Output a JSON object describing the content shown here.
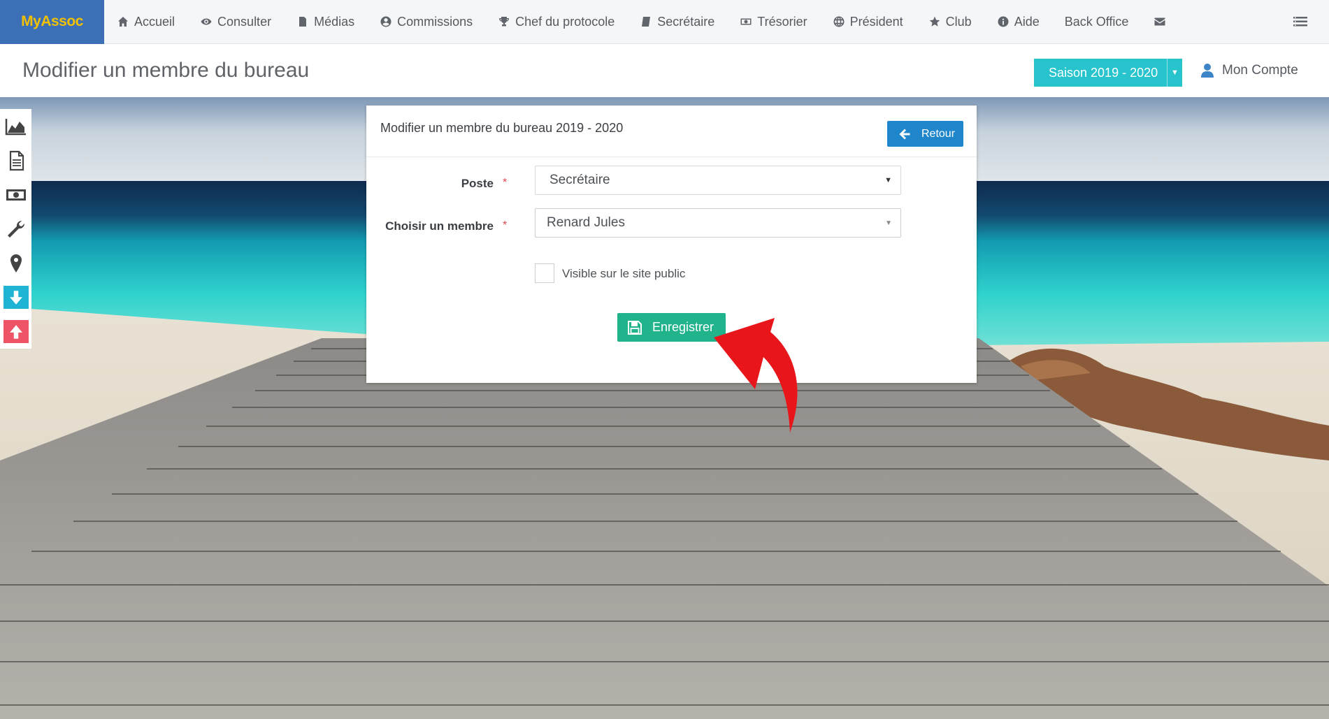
{
  "brand": "MyAssoc",
  "nav": [
    {
      "label": "Accueil",
      "icon": "home-icon"
    },
    {
      "label": "Consulter",
      "icon": "eye-icon"
    },
    {
      "label": "Médias",
      "icon": "file-icon"
    },
    {
      "label": "Commissions",
      "icon": "user-circle-icon"
    },
    {
      "label": "Chef du protocole",
      "icon": "trophy-icon"
    },
    {
      "label": "Secrétaire",
      "icon": "book-icon"
    },
    {
      "label": "Trésorier",
      "icon": "money-icon"
    },
    {
      "label": "Président",
      "icon": "globe-icon"
    },
    {
      "label": "Club",
      "icon": "star-icon"
    },
    {
      "label": "Aide",
      "icon": "info-icon"
    },
    {
      "label": "Back Office",
      "icon": ""
    },
    {
      "label": "",
      "icon": "envelope-icon"
    }
  ],
  "header": {
    "title": "Modifier un membre du bureau",
    "season": "Saison 2019 - 2020",
    "account": "Mon Compte"
  },
  "form": {
    "title": "Modifier un membre du bureau 2019 - 2020",
    "back_label": "Retour",
    "poste_label": "Poste",
    "poste_value": "Secrétaire",
    "membre_label": "Choisir un membre",
    "membre_value": "Renard Jules",
    "required_mark": "*",
    "visible_label": "Visible sur le site public",
    "visible_checked": false,
    "save_label": "Enregistrer"
  },
  "colors": {
    "brand_bg": "#3d6fb6",
    "brand_text": "#f2c200",
    "season_bg": "#27c4ce",
    "back_btn": "#1f86cc",
    "save_btn": "#20b38c",
    "arrow": "#e8161b"
  }
}
